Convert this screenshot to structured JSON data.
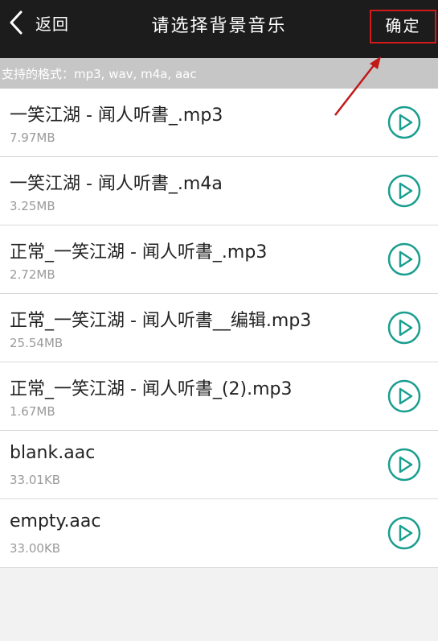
{
  "header": {
    "back_label": "返回",
    "title": "请选择背景音乐",
    "confirm_label": "确定"
  },
  "formats_text": "支持的格式：mp3, wav, m4a, aac",
  "files": [
    {
      "name": "一笑江湖 - 闻人听書_.mp3",
      "size": "7.97MB"
    },
    {
      "name": "一笑江湖 - 闻人听書_.m4a",
      "size": "3.25MB"
    },
    {
      "name": "正常_一笑江湖 - 闻人听書_.mp3",
      "size": "2.72MB"
    },
    {
      "name": "正常_一笑江湖 - 闻人听書__编辑.mp3",
      "size": "25.54MB"
    },
    {
      "name": "正常_一笑江湖 - 闻人听書_(2).mp3",
      "size": "1.67MB"
    },
    {
      "name": "blank.aac",
      "size": "33.01KB"
    },
    {
      "name": "empty.aac",
      "size": "33.00KB"
    }
  ],
  "colors": {
    "header_bg": "#1c1c1c",
    "accent_teal": "#1a9e8f",
    "highlight_red": "#d21a1a"
  },
  "icons": {
    "back": "chevron-left-icon",
    "play": "play-circle-icon"
  }
}
